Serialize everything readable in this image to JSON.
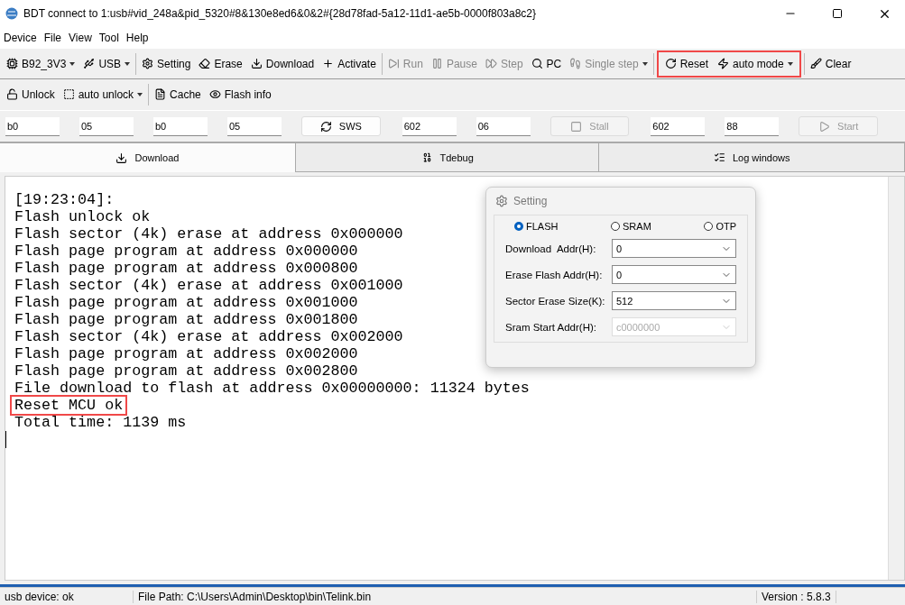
{
  "window": {
    "title": "BDT connect to 1:usb#vid_248a&pid_5320#8&130e8ed6&0&2#{28d78fad-5a12-11d1-ae5b-0000f803a8c2}"
  },
  "menu": [
    "Device",
    "File",
    "View",
    "Tool",
    "Help"
  ],
  "toolbar": [
    {
      "label": "B92_3V3",
      "kind": "dropdown",
      "disabled": false,
      "highlighted": false
    },
    {
      "label": "USB",
      "kind": "dropdown",
      "disabled": false,
      "highlighted": false
    },
    {
      "kind": "separator"
    },
    {
      "label": "Setting",
      "kind": "button",
      "disabled": false,
      "highlighted": false
    },
    {
      "label": "Erase",
      "kind": "button",
      "disabled": false,
      "highlighted": false
    },
    {
      "label": "Download",
      "kind": "button",
      "disabled": false,
      "highlighted": false
    },
    {
      "label": "Activate",
      "kind": "button",
      "disabled": false,
      "highlighted": false
    },
    {
      "kind": "separator"
    },
    {
      "label": "Run",
      "kind": "button",
      "disabled": true,
      "highlighted": false
    },
    {
      "label": "Pause",
      "kind": "button",
      "disabled": true,
      "highlighted": false
    },
    {
      "label": "Step",
      "kind": "button",
      "disabled": true,
      "highlighted": false
    },
    {
      "label": "PC",
      "kind": "button",
      "disabled": false,
      "highlighted": false
    },
    {
      "label": "Single step",
      "kind": "dropdown",
      "disabled": true,
      "highlighted": false
    },
    {
      "kind": "separator"
    },
    {
      "label": "Reset",
      "kind": "button",
      "disabled": false,
      "highlighted": true
    },
    {
      "label": "auto mode",
      "kind": "dropdown",
      "disabled": false,
      "highlighted": true
    },
    {
      "kind": "separator"
    },
    {
      "label": "Clear",
      "kind": "button",
      "disabled": false,
      "highlighted": false
    }
  ],
  "toolbar2": [
    {
      "label": "Unlock",
      "kind": "button"
    },
    {
      "label": "auto unlock",
      "kind": "dropdown"
    },
    {
      "kind": "separator"
    },
    {
      "label": "Cache",
      "kind": "button"
    },
    {
      "label": "Flash info",
      "kind": "button"
    }
  ],
  "fields": [
    {
      "kind": "input",
      "value": "b0"
    },
    {
      "kind": "input",
      "value": "05"
    },
    {
      "kind": "input",
      "value": "b0"
    },
    {
      "kind": "input",
      "value": "05"
    },
    {
      "kind": "button",
      "label": "SWS",
      "disabled": false
    },
    {
      "kind": "input",
      "value": "602"
    },
    {
      "kind": "input",
      "value": "06"
    },
    {
      "kind": "button",
      "label": "Stall",
      "disabled": true
    },
    {
      "kind": "input",
      "value": "602"
    },
    {
      "kind": "input",
      "value": "88"
    },
    {
      "kind": "button",
      "label": "Start",
      "disabled": true
    }
  ],
  "tabs": [
    {
      "label": "Download",
      "selected": true
    },
    {
      "label": "Tdebug",
      "selected": false
    },
    {
      "label": "Log windows",
      "selected": false
    }
  ],
  "log": [
    {
      "text": "[19:23:04]:",
      "highlighted": false
    },
    {
      "text": "Flash unlock ok",
      "highlighted": false
    },
    {
      "text": "Flash sector (4k) erase at address 0x000000",
      "highlighted": false
    },
    {
      "text": "Flash page program at address 0x000000",
      "highlighted": false
    },
    {
      "text": "Flash page program at address 0x000800",
      "highlighted": false
    },
    {
      "text": "Flash sector (4k) erase at address 0x001000",
      "highlighted": false
    },
    {
      "text": "Flash page program at address 0x001000",
      "highlighted": false
    },
    {
      "text": "Flash page program at address 0x001800",
      "highlighted": false
    },
    {
      "text": "Flash sector (4k) erase at address 0x002000",
      "highlighted": false
    },
    {
      "text": "Flash page program at address 0x002000",
      "highlighted": false
    },
    {
      "text": "Flash page program at address 0x002800",
      "highlighted": false
    },
    {
      "text": "File download to flash at address 0x00000000: 11324 bytes",
      "highlighted": false
    },
    {
      "text": "Reset MCU ok",
      "highlighted": true
    },
    {
      "text": "Total time: 1139 ms",
      "highlighted": false
    }
  ],
  "dialog": {
    "title": "Setting",
    "options": [
      {
        "label": "FLASH",
        "selected": true
      },
      {
        "label": "SRAM",
        "selected": false
      },
      {
        "label": "OTP",
        "selected": false
      }
    ],
    "rows": [
      {
        "label": "Download  Addr(H):",
        "value": "0",
        "disabled": false
      },
      {
        "label": "Erase Flash Addr(H):",
        "value": "0",
        "disabled": false
      },
      {
        "label": "Sector Erase Size(K):",
        "value": "512",
        "disabled": false
      },
      {
        "label": "Sram Start Addr(H):",
        "value": "c0000000",
        "disabled": true
      }
    ]
  },
  "status_bar": [
    "usb device: ok",
    "File Path:  C:\\Users\\Admin\\Desktop\\bin\\Telink.bin",
    "Version : 5.8.3"
  ]
}
